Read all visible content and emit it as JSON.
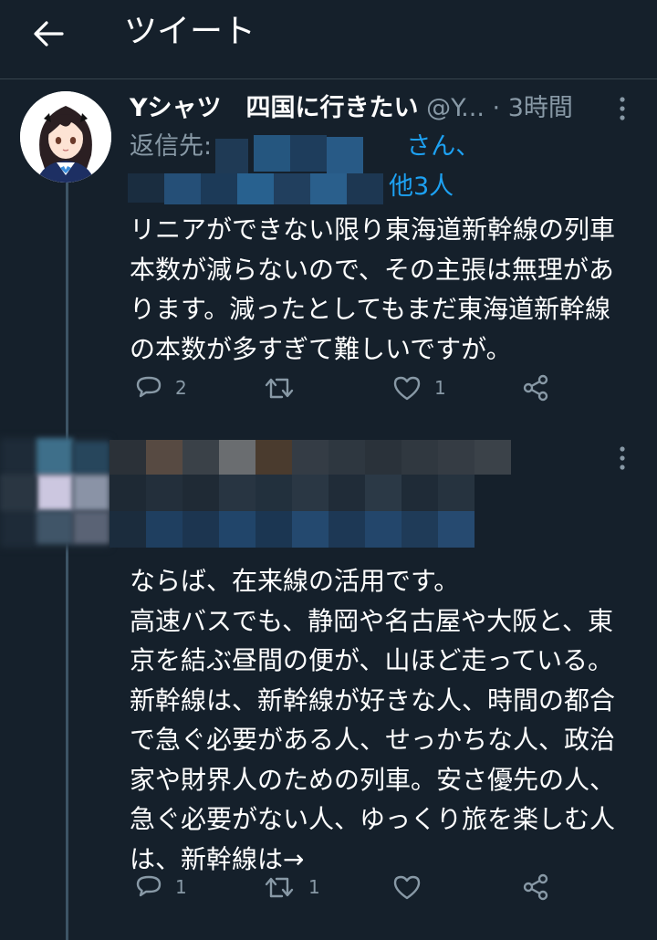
{
  "header": {
    "title": "ツイート"
  },
  "tweets": [
    {
      "name": "Yシャツ　四国に行きたい",
      "handle": "@Y...",
      "time": "· 3時間",
      "reply_prefix": "返信先:",
      "reply_line1_suffix": "さん、",
      "reply_others": "他3人",
      "text": "リニアができない限り東海道新幹線の列車\n本数が減らないので、その主張は無理があ\nります。減ったとしてもまだ東海道新幹線\nの本数が多すぎて難しいですが。",
      "replies": "2",
      "retweets": "",
      "likes": "1"
    },
    {
      "text": "ならば、在来線の活用です。\n高速バスでも、静岡や名古屋や大阪と、東\n京を結ぶ昼間の便が、山ほど走っている。\n新幹線は、新幹線が好きな人、時間の都合\nで急ぐ必要がある人、せっかちな人、政治\n家や財界人のための列車。安さ優先の人、\n急ぐ必要がない人、ゆっくり旅を楽しむ人\nは、新幹線は→",
      "replies": "1",
      "retweets": "1",
      "likes": ""
    }
  ],
  "colors": {
    "background": "#15202b",
    "muted": "#8899a6",
    "link": "#1da1f2",
    "divider": "#38444d"
  },
  "icons": [
    "back-arrow-icon",
    "more-icon",
    "reply-icon",
    "retweet-icon",
    "like-icon",
    "share-icon"
  ]
}
